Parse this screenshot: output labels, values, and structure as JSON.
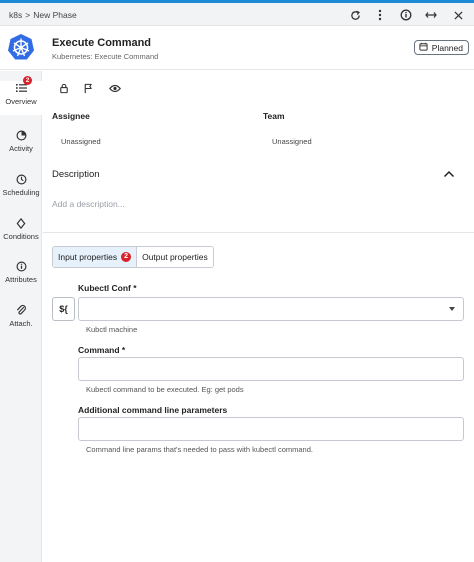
{
  "breadcrumb": {
    "root": "k8s",
    "separator": ">",
    "current": "New Phase"
  },
  "topbar_icons": [
    "refresh-icon",
    "more-vertical-icon",
    "info-icon",
    "expand-horizontal-icon",
    "close-icon"
  ],
  "header": {
    "title": "Execute Command",
    "subtitle": "Kubernetes: Execute Command",
    "status_label": "Planned",
    "status_icon": "calendar-icon"
  },
  "sidebar": {
    "items": [
      {
        "label": "Overview",
        "icon": "list-icon",
        "badge": "2",
        "active": true
      },
      {
        "label": "Activity",
        "icon": "activity-icon"
      },
      {
        "label": "Scheduling",
        "icon": "clock-icon"
      },
      {
        "label": "Conditions",
        "icon": "diamond-icon"
      },
      {
        "label": "Attributes",
        "icon": "info-icon"
      },
      {
        "label": "Attach.",
        "icon": "paperclip-icon"
      }
    ]
  },
  "actions": [
    "lock-icon",
    "flag-icon",
    "eye-icon"
  ],
  "assignee": {
    "label": "Assignee",
    "value": "Unassigned"
  },
  "team": {
    "label": "Team",
    "value": "Unassigned"
  },
  "description": {
    "label": "Description",
    "placeholder": "Add a description..."
  },
  "tabs": [
    {
      "label": "Input properties",
      "badge": "2",
      "active": true
    },
    {
      "label": "Output properties"
    }
  ],
  "form": {
    "expression_button": "${",
    "kubectl_conf": {
      "label": "Kubectl Conf *",
      "value": "",
      "help": "Kubctl machine"
    },
    "command": {
      "label": "Command *",
      "value": "",
      "help": "Kubectl command to be executed. Eg: get pods"
    },
    "additional_params": {
      "label": "Additional command line parameters",
      "value": "",
      "help": "Command line params that's needed to pass with kubectl command."
    }
  },
  "colors": {
    "accent": "#1c8ad6",
    "logo": "#326ce5",
    "badge": "#d9222a",
    "active_tab_bg": "#e6f1fb"
  }
}
